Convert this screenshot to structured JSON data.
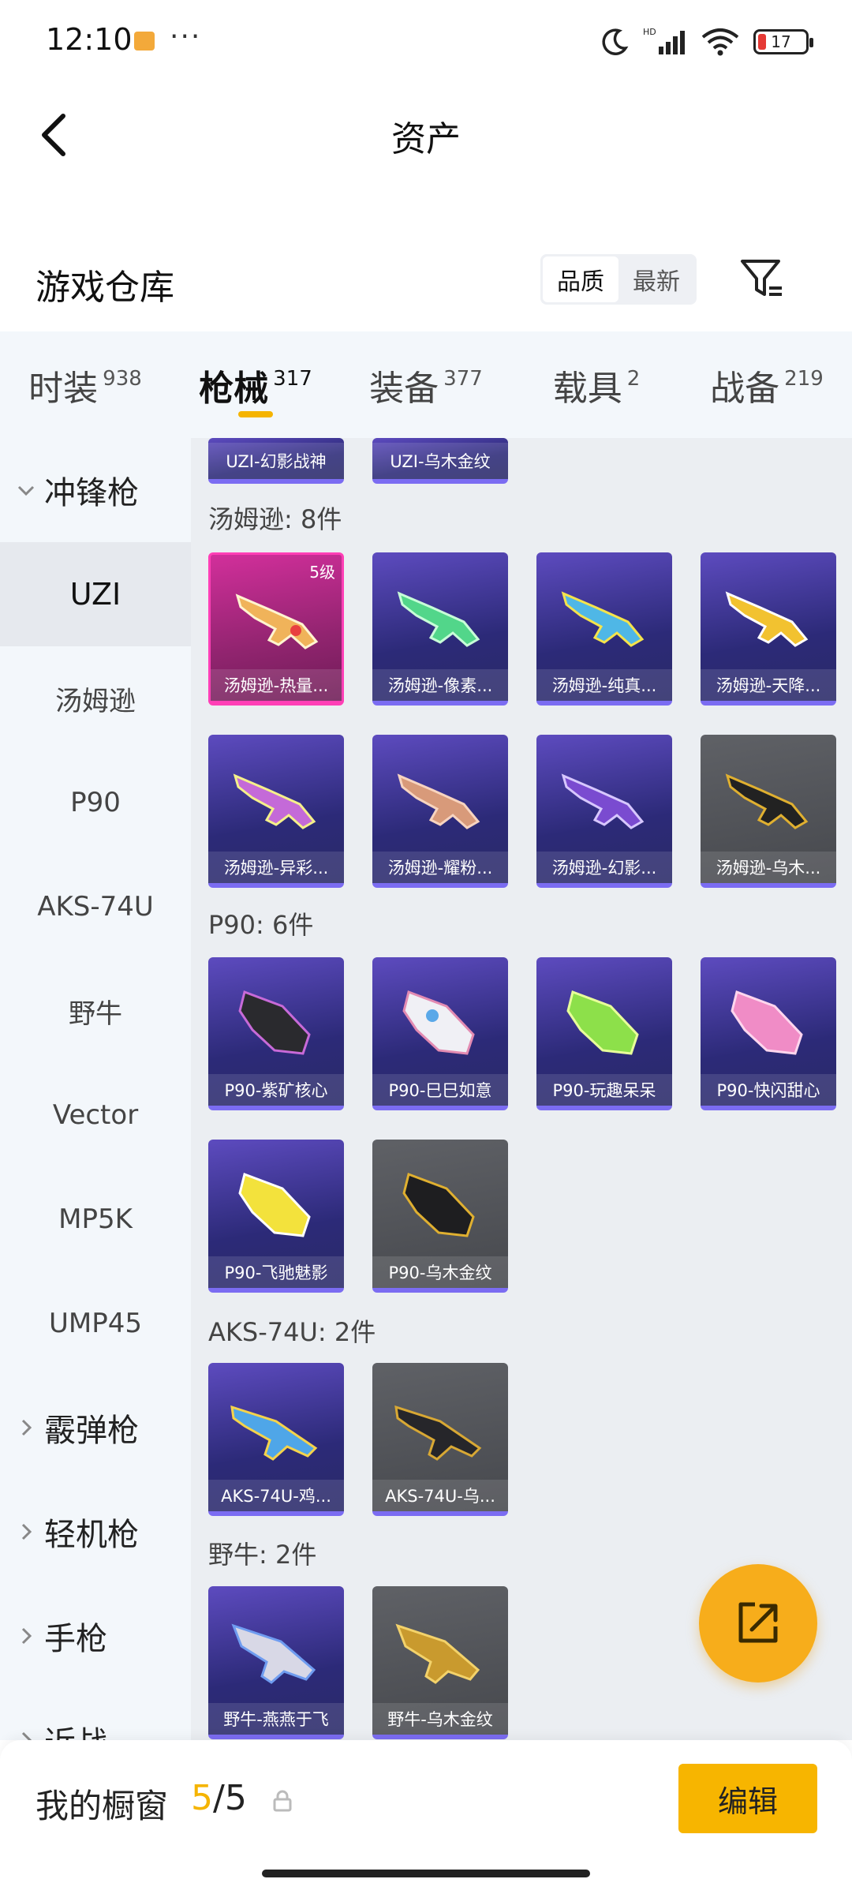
{
  "status_bar": {
    "time": "12:10",
    "dots": "···",
    "battery": "17"
  },
  "header": {
    "title": "资产"
  },
  "warehouse": {
    "title": "游戏仓库",
    "sort_options": [
      "品质",
      "最新"
    ],
    "active_sort": "品质"
  },
  "tabs": [
    {
      "label": "时装",
      "count": "938"
    },
    {
      "label": "枪械",
      "count": "317",
      "active": true
    },
    {
      "label": "装备",
      "count": "377"
    },
    {
      "label": "载具",
      "count": "2"
    },
    {
      "label": "战备",
      "count": "219"
    }
  ],
  "sidenav": {
    "group_open": "冲锋枪",
    "items": [
      "UZI",
      "汤姆逊",
      "P90",
      "AKS-74U",
      "野牛",
      "Vector",
      "MP5K",
      "UMP45"
    ],
    "active_item": "UZI",
    "collapsed_groups": [
      "霰弹枪",
      "轻机枪",
      "手枪",
      "近战"
    ]
  },
  "sections": [
    {
      "title": "",
      "items": [
        {
          "name": "UZI-幻影战神",
          "style": "purple"
        },
        {
          "name": "UZI-乌木金纹",
          "style": "purple"
        }
      ]
    },
    {
      "title": "汤姆逊: 8件",
      "items": [
        {
          "name": "汤姆逊-热量...",
          "style": "pink",
          "level": "5级"
        },
        {
          "name": "汤姆逊-像素...",
          "style": "purple"
        },
        {
          "name": "汤姆逊-纯真...",
          "style": "purple"
        },
        {
          "name": "汤姆逊-天降...",
          "style": "purple"
        },
        {
          "name": "汤姆逊-异彩...",
          "style": "purple"
        },
        {
          "name": "汤姆逊-耀粉...",
          "style": "purple"
        },
        {
          "name": "汤姆逊-幻影...",
          "style": "purple"
        },
        {
          "name": "汤姆逊-乌木...",
          "style": "gray"
        }
      ]
    },
    {
      "title": "P90: 6件",
      "items": [
        {
          "name": "P90-紫矿核心",
          "style": "purple"
        },
        {
          "name": "P90-巳巳如意",
          "style": "purple"
        },
        {
          "name": "P90-玩趣呆呆",
          "style": "purple"
        },
        {
          "name": "P90-快闪甜心",
          "style": "purple"
        },
        {
          "name": "P90-飞驰魅影",
          "style": "purple"
        },
        {
          "name": "P90-乌木金纹",
          "style": "gray"
        }
      ]
    },
    {
      "title": "AKS-74U: 2件",
      "items": [
        {
          "name": "AKS-74U-鸡...",
          "style": "purple"
        },
        {
          "name": "AKS-74U-乌...",
          "style": "gray"
        }
      ]
    },
    {
      "title": "野牛: 2件",
      "items": [
        {
          "name": "野牛-燕燕于飞",
          "style": "purple"
        },
        {
          "name": "野牛-乌木金纹",
          "style": "gray"
        }
      ]
    }
  ],
  "bottom_bar": {
    "label": "我的橱窗",
    "used": "5",
    "separator": "/",
    "total": "5",
    "edit_label": "编辑"
  },
  "colors": {
    "accent": "#f5b400",
    "rare_purple": "#2c2a78",
    "legend_pink": "#d22f9b",
    "base_gray": "#46484d"
  }
}
